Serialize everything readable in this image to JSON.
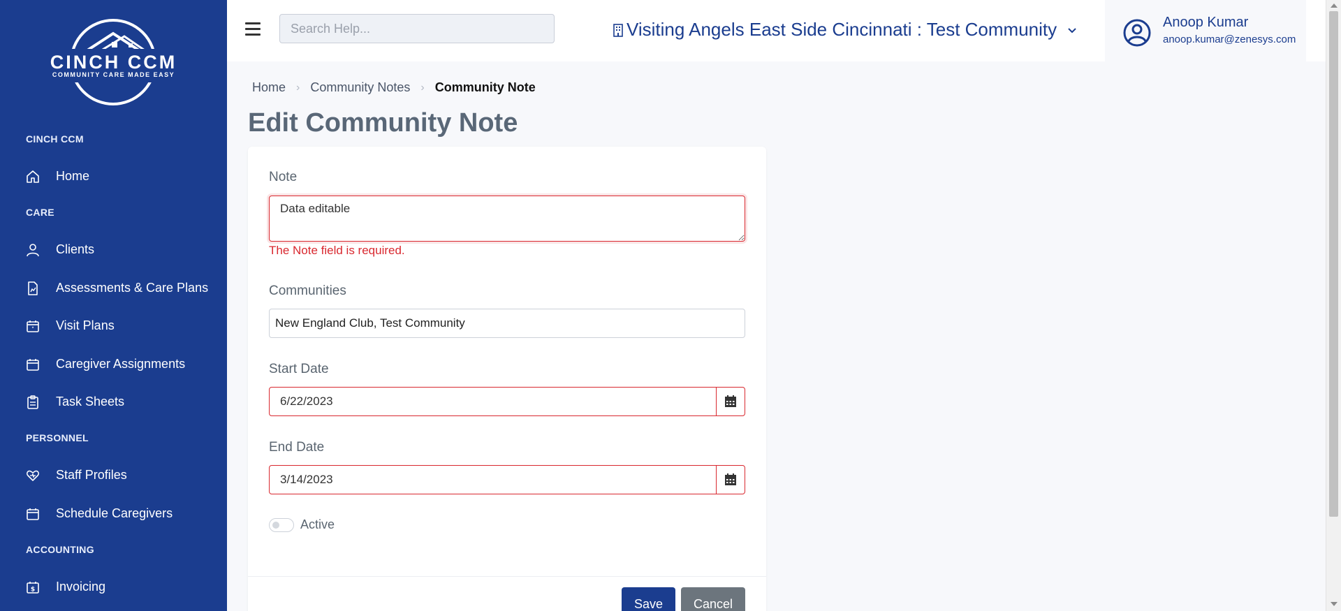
{
  "brand": {
    "logo_main": "CINCH CCM",
    "logo_sub": "COMMUNITY CARE MADE EASY"
  },
  "sidebar": {
    "sections": [
      {
        "label": "CINCH CCM"
      },
      {
        "label": "CARE"
      },
      {
        "label": "PERSONNEL"
      },
      {
        "label": "ACCOUNTING"
      }
    ],
    "items": [
      {
        "label": "Home",
        "icon": "home-icon"
      },
      {
        "label": "Clients",
        "icon": "person-icon"
      },
      {
        "label": "Assessments & Care Plans",
        "icon": "document-chart-icon"
      },
      {
        "label": "Visit Plans",
        "icon": "calendar-star-icon"
      },
      {
        "label": "Caregiver Assignments",
        "icon": "calendar-icon"
      },
      {
        "label": "Task Sheets",
        "icon": "clipboard-icon"
      },
      {
        "label": "Staff Profiles",
        "icon": "heart-hand-icon"
      },
      {
        "label": "Schedule Caregivers",
        "icon": "calendar-icon"
      },
      {
        "label": "Invoicing",
        "icon": "invoice-icon"
      }
    ]
  },
  "header": {
    "search_placeholder": "Search Help...",
    "agency": "Visiting Angels East Side Cincinnati : Test Community",
    "user_name": "Anoop Kumar",
    "user_email": "anoop.kumar@zenesys.com"
  },
  "breadcrumb": {
    "home": "Home",
    "parent": "Community Notes",
    "current": "Community Note"
  },
  "page_title": "Edit Community Note",
  "form": {
    "note_label": "Note",
    "note_value": "Data editable",
    "note_error": "The Note field is required.",
    "communities_label": "Communities",
    "communities_value": "New England Club, Test Community",
    "start_date_label": "Start Date",
    "start_date_value": "6/22/2023",
    "end_date_label": "End Date",
    "end_date_value": "3/14/2023",
    "active_label": "Active",
    "active": false,
    "save_label": "Save",
    "cancel_label": "Cancel"
  },
  "colors": {
    "sidebar_bg": "#1b3d8f",
    "accent": "#1b3d8f",
    "error": "#d9282f",
    "cancel_bg": "#6c757d"
  }
}
